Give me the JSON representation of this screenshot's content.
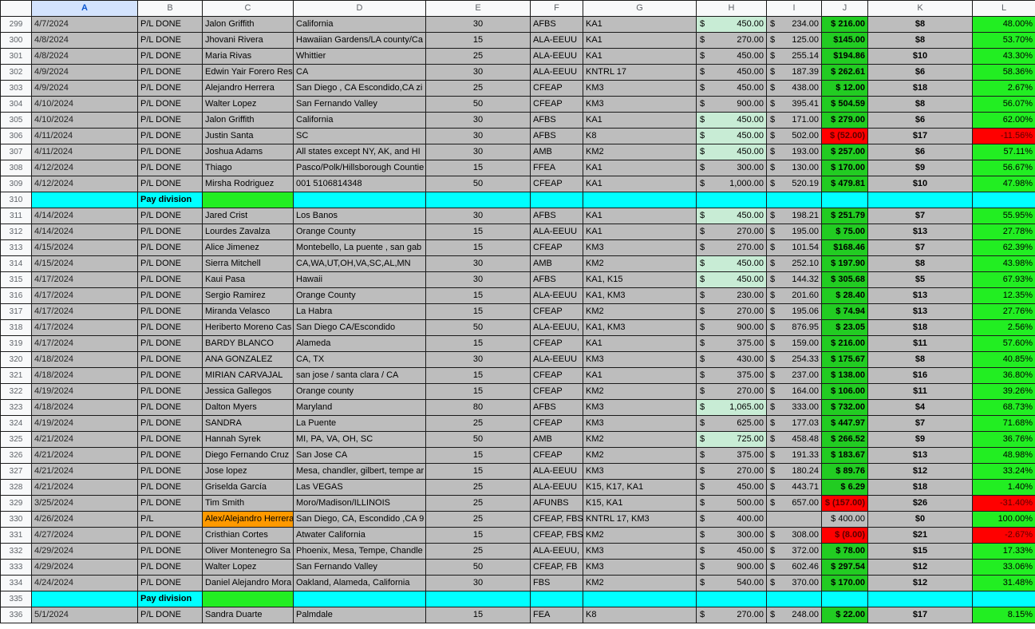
{
  "columns": [
    "A",
    "B",
    "C",
    "D",
    "E",
    "F",
    "G",
    "H",
    "I",
    "J",
    "K",
    "L"
  ],
  "divider_label": "Pay division",
  "rows": [
    {
      "n": "299",
      "a": "4/7/2024",
      "b": "P/L DONE",
      "c": "Jalon Griffith",
      "d": "California",
      "e": "30",
      "f": "AFBS",
      "g": "KA1",
      "h": "450.00",
      "i": "234.00",
      "j": "$ 216.00",
      "k": "$8",
      "l": "48.00%",
      "hhl": true
    },
    {
      "n": "300",
      "a": "4/8/2024",
      "b": "P/L DONE",
      "c": "Jhovani Rivera",
      "d": "Hawaiian Gardens/LA county/Ca",
      "e": "15",
      "f": "ALA-EEUU",
      "g": "KA1",
      "h": "270.00",
      "i": "125.00",
      "j": "$145.00",
      "k": "$8",
      "l": "53.70%"
    },
    {
      "n": "301",
      "a": "4/8/2024",
      "b": "P/L DONE",
      "c": "Maria Rivas",
      "d": "Whittier",
      "e": "25",
      "f": " ALA-EEUU",
      "g": "KA1",
      "h": "450.00",
      "i": "255.14",
      "j": "$194.86",
      "k": "$10",
      "l": "43.30%"
    },
    {
      "n": "302",
      "a": "4/9/2024",
      "b": "P/L DONE",
      "c": "Edwin Yair Forero Res",
      "d": "CA",
      "e": "30",
      "f": "ALA-EEUU",
      "g": "KNTRL 17",
      "h": "450.00",
      "i": "187.39",
      "j": "$ 262.61",
      "k": "$6",
      "l": "58.36%"
    },
    {
      "n": "303",
      "a": "4/9/2024",
      "b": "P/L DONE",
      "c": "Alejandro Herrera",
      "d": "San Diego , CA Escondido,CA zi",
      "e": "25",
      "f": "CFEAP",
      "g": "KM3",
      "h": "450.00",
      "i": "438.00",
      "j": "$  12.00",
      "k": "$18",
      "l": "2.67%"
    },
    {
      "n": "304",
      "a": "4/10/2024",
      "b": "P/L DONE",
      "c": "Walter Lopez",
      "d": "San Fernando Valley",
      "e": "50",
      "f": "CFEAP",
      "g": "KM3",
      "h": "900.00",
      "i": "395.41",
      "j": "$ 504.59",
      "k": "$8",
      "l": "56.07%"
    },
    {
      "n": "305",
      "a": "4/10/2024",
      "b": "P/L DONE",
      "c": "Jalon Griffith",
      "d": "California",
      "e": "30",
      "f": "AFBS",
      "g": "KA1",
      "h": "450.00",
      "i": "171.00",
      "j": "$ 279.00",
      "k": "$6",
      "l": "62.00%",
      "hhl": true
    },
    {
      "n": "306",
      "a": "4/11/2024",
      "b": "P/L DONE",
      "c": "Justin Santa",
      "d": "SC",
      "e": "30",
      "f": "AFBS",
      "g": "K8",
      "h": "450.00",
      "i": "502.00",
      "j": "$  (52.00)",
      "k": "$17",
      "l": "-11.56%",
      "hhl": true,
      "neg": true
    },
    {
      "n": "307",
      "a": "4/11/2024",
      "b": "P/L DONE",
      "c": "Joshua Adams",
      "d": "All states except NY, AK, and HI",
      "e": "30",
      "f": "AMB",
      "g": "KM2",
      "h": "450.00",
      "i": "193.00",
      "j": "$ 257.00",
      "k": "$6",
      "l": "57.11%",
      "hhl": true
    },
    {
      "n": "308",
      "a": "4/12/2024",
      "b": "P/L DONE",
      "c": "Thiago",
      "d": "Pasco/Polk/Hillsborough Countie",
      "e": "15",
      "f": "FFEA",
      "g": "KA1",
      "h": "300.00",
      "i": "130.00",
      "j": "$ 170.00",
      "k": "$9",
      "l": "56.67%"
    },
    {
      "n": "309",
      "a": "4/12/2024",
      "b": "P/L DONE",
      "c": "Mirsha Rodriguez",
      "d": "001 5106814348",
      "e": "50",
      "f": "CFEAP",
      "g": "KA1",
      "h": "1,000.00",
      "i": "520.19",
      "j": "$ 479.81",
      "k": "$10",
      "l": "47.98%"
    },
    {
      "n": "310",
      "divider": true
    },
    {
      "n": "311",
      "a": "4/14/2024",
      "b": "P/L DONE",
      "c": "Jared Crist",
      "d": "Los Banos",
      "e": "30",
      "f": "AFBS",
      "g": "KA1",
      "h": "450.00",
      "i": "198.21",
      "j": "$ 251.79",
      "k": "$7",
      "l": "55.95%",
      "hhl": true
    },
    {
      "n": "312",
      "a": "4/14/2024",
      "b": "P/L DONE",
      "c": "Lourdes Zavalza",
      "d": "Orange County",
      "e": "15",
      "f": "ALA-EEUU",
      "g": "KA1",
      "h": "270.00",
      "i": "195.00",
      "j": "$  75.00",
      "k": "$13",
      "l": "27.78%"
    },
    {
      "n": "313",
      "a": "4/15/2024",
      "b": "P/L DONE",
      "c": "Alice Jimenez",
      "d": "Montebello, La puente , san gab",
      "e": "15",
      "f": "CFEAP",
      "g": "KM3",
      "h": "270.00",
      "i": "101.54",
      "j": "$168.46",
      "k": "$7",
      "l": "62.39%"
    },
    {
      "n": "314",
      "a": "4/15/2024",
      "b": "P/L DONE",
      "c": "Sierra Mitchell",
      "d": "CA,WA,UT,OH,VA,SC,AL,MN",
      "e": "30",
      "f": "AMB",
      "g": "KM2",
      "h": "450.00",
      "i": "252.10",
      "j": "$ 197.90",
      "k": "$8",
      "l": "43.98%",
      "hhl": true
    },
    {
      "n": "315",
      "a": "4/17/2024",
      "b": "P/L DONE",
      "c": "Kaui Pasa",
      "d": "Hawaii",
      "e": "30",
      "f": "AFBS",
      "g": "KA1, K15",
      "h": "450.00",
      "i": "144.32",
      "j": "$ 305.68",
      "k": "$5",
      "l": "67.93%",
      "hhl": true
    },
    {
      "n": "316",
      "a": "4/17/2024",
      "b": "P/L DONE",
      "c": "Sergio Ramirez",
      "d": "Orange County",
      "e": "15",
      "f": "ALA-EEUU",
      "g": "KA1, KM3",
      "h": "230.00",
      "i": "201.60",
      "j": "$  28.40",
      "k": "$13",
      "l": "12.35%"
    },
    {
      "n": "317",
      "a": "4/17/2024",
      "b": "P/L DONE",
      "c": "Miranda Velasco",
      "d": "La Habra",
      "e": "15",
      "f": "CFEAP",
      "g": "KM2",
      "h": "270.00",
      "i": "195.06",
      "j": "$  74.94",
      "k": "$13",
      "l": "27.76%"
    },
    {
      "n": "318",
      "a": "4/17/2024",
      "b": "P/L DONE",
      "c": "Heriberto Moreno Cas",
      "d": "San Diego CA/Escondido",
      "e": "50",
      "f": "ALA-EEUU,",
      "g": "KA1, KM3",
      "h": "900.00",
      "i": "876.95",
      "j": "$  23.05",
      "k": "$18",
      "l": "2.56%"
    },
    {
      "n": "319",
      "a": "4/17/2024",
      "b": "P/L DONE",
      "c": "BARDY BLANCO",
      "d": "Alameda",
      "e": "15",
      "f": "CFEAP",
      "g": "KA1",
      "h": "375.00",
      "i": "159.00",
      "j": "$ 216.00",
      "k": "$11",
      "l": "57.60%"
    },
    {
      "n": "320",
      "a": "4/18/2024",
      "b": "P/L DONE",
      "c": "ANA GONZALEZ",
      "d": "CA, TX",
      "e": "30",
      "f": "ALA-EEUU",
      "g": "KM3",
      "h": "430.00",
      "i": "254.33",
      "j": "$ 175.67",
      "k": "$8",
      "l": "40.85%"
    },
    {
      "n": "321",
      "a": "4/18/2024",
      "b": "P/L DONE",
      "c": "MIRIAN CARVAJAL",
      "d": "san jose / santa clara / CA",
      "e": "15",
      "f": "CFEAP",
      "g": "KA1",
      "h": "375.00",
      "i": "237.00",
      "j": "$ 138.00",
      "k": "$16",
      "l": "36.80%"
    },
    {
      "n": "322",
      "a": "4/19/2024",
      "b": "P/L DONE",
      "c": "Jessica Gallegos",
      "d": "Orange county",
      "e": "15",
      "f": "CFEAP",
      "g": "KM2",
      "h": "270.00",
      "i": "164.00",
      "j": "$ 106.00",
      "k": "$11",
      "l": "39.26%"
    },
    {
      "n": "323",
      "a": "4/18/2024",
      "b": "P/L DONE",
      "c": "Dalton Myers",
      "d": "Maryland",
      "e": "80",
      "f": "AFBS",
      "g": "KM3",
      "h": "1,065.00",
      "i": "333.00",
      "j": "$ 732.00",
      "k": "$4",
      "l": "68.73%",
      "hhl": true
    },
    {
      "n": "324",
      "a": "4/19/2024",
      "b": "P/L DONE",
      "c": "SANDRA",
      "d": "La Puente",
      "e": "25",
      "f": "CFEAP",
      "g": "KM3",
      "h": "625.00",
      "i": "177.03",
      "j": "$ 447.97",
      "k": "$7",
      "l": "71.68%"
    },
    {
      "n": "325",
      "a": "4/21/2024",
      "b": "P/L DONE",
      "c": "Hannah Syrek",
      "d": "MI, PA, VA, OH, SC",
      "e": "50",
      "f": "AMB",
      "g": "KM2",
      "h": "725.00",
      "i": "458.48",
      "j": "$ 266.52",
      "k": "$9",
      "l": "36.76%",
      "hhl": true
    },
    {
      "n": "326",
      "a": "4/21/2024",
      "b": "P/L DONE",
      "c": "Diego Fernando Cruz",
      "d": "San Jose CA",
      "e": "15",
      "f": "CFEAP",
      "g": "KM2",
      "h": "375.00",
      "i": "191.33",
      "j": "$ 183.67",
      "k": "$13",
      "l": "48.98%"
    },
    {
      "n": "327",
      "a": "4/21/2024",
      "b": "P/L DONE",
      "c": "Jose lopez",
      "d": "Mesa, chandler, gilbert, tempe ar",
      "e": "15",
      "f": "ALA-EEUU",
      "g": "KM3",
      "h": "270.00",
      "i": "180.24",
      "j": "$  89.76",
      "k": "$12",
      "l": "33.24%"
    },
    {
      "n": "328",
      "a": "4/21/2024",
      "b": "P/L DONE",
      "c": "Griselda García",
      "d": "Las VEGAS",
      "e": "25",
      "f": " ALA-EEUU",
      "g": "K15, K17, KA1",
      "h": "450.00",
      "i": "443.71",
      "j": "$   6.29",
      "k": "$18",
      "l": "1.40%"
    },
    {
      "n": "329",
      "a": "3/25/2024",
      "b": "P/L DONE",
      "c": "Tim Smith",
      "d": "Moro/Madison/ILLINOIS",
      "e": "25",
      "f": "AFUNBS",
      "g": "K15, KA1",
      "h": "500.00",
      "i": "657.00",
      "j": "$ (157.00)",
      "k": "$26",
      "l": "-31.40%",
      "neg": true,
      "tall": true
    },
    {
      "n": "330",
      "a": "4/26/2024",
      "b": "P/L",
      "c": "Alex/Alejandro Herrera",
      "d": "San Diego, CA, Escondido ,CA 9",
      "e": "25",
      "f": "CFEAP, FBS",
      "g": "KNTRL 17, KM3",
      "h": "400.00",
      "i": "",
      "j": "$ 400.00",
      "k": "$0",
      "l": "100.00%",
      "orange": true,
      "bcenter": true,
      "jplain": true
    },
    {
      "n": "331",
      "a": "4/27/2024",
      "b": "P/L DONE",
      "c": "Cristhian Cortes",
      "d": "Atwater California",
      "e": "15",
      "f": "CFEAP, FBS",
      "g": "KM2",
      "h": "300.00",
      "i": "308.00",
      "j": "$   (8.00)",
      "k": "$21",
      "l": "-2.67%",
      "neg": true
    },
    {
      "n": "332",
      "a": "4/29/2024",
      "b": "P/L DONE",
      "c": "Oliver Montenegro Sa",
      "d": "Phoenix, Mesa, Tempe, Chandle",
      "e": "25",
      "f": "ALA-EEUU,",
      "g": "KM3",
      "h": "450.00",
      "i": "372.00",
      "j": "$  78.00",
      "k": "$15",
      "l": "17.33%"
    },
    {
      "n": "333",
      "a": "4/29/2024",
      "b": "P/L DONE",
      "c": "Walter Lopez",
      "d": "San Fernando Valley",
      "e": "50",
      "f": "CFEAP, FB",
      "g": "KM3",
      "h": "900.00",
      "i": "602.46",
      "j": "$ 297.54",
      "k": "$12",
      "l": "33.06%"
    },
    {
      "n": "334",
      "a": "4/24/2024",
      "b": "P/L DONE",
      "c": "Daniel Alejandro Mora",
      "d": "Oakland, Alameda, California",
      "e": "30",
      "f": "FBS",
      "g": "KM2",
      "h": "540.00",
      "i": "370.00",
      "j": "$ 170.00",
      "k": "$12",
      "l": "31.48%"
    },
    {
      "n": "335",
      "divider": true
    },
    {
      "n": "336",
      "a": "5/1/2024",
      "b": "P/L DONE",
      "c": "Sandra Duarte",
      "d": "Palmdale",
      "e": "15",
      "f": "FEA",
      "g": "K8",
      "h": "270.00",
      "i": "248.00",
      "j": "$  22.00",
      "k": "$17",
      "l": "8.15%"
    }
  ],
  "currency_symbol": "$",
  "colors": {
    "cell_gray": "#bdbdbd",
    "profit_green": "#22cc22",
    "percent_green": "#22ee22",
    "loss_red": "#ff0000",
    "divider_cyan": "#00ffff",
    "highlight_mint": "#c8ecd5",
    "flag_orange": "#ff9900",
    "header_selected": "#d3e3fd"
  }
}
